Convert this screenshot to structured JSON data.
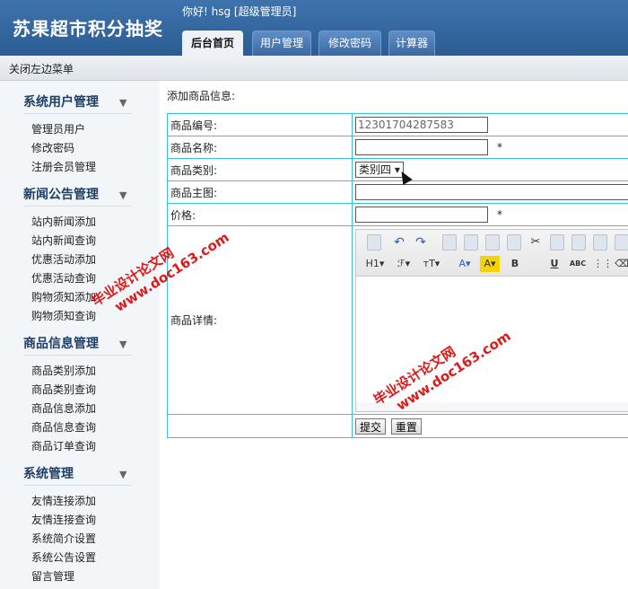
{
  "header": {
    "app_title": "苏果超市积分抽奖",
    "greeting": "你好! hsg [超级管理员]",
    "tabs": [
      "后台首页",
      "用户管理",
      "修改密码",
      "计算器"
    ]
  },
  "strip": {
    "close_menu": "关闭左边菜单"
  },
  "sidebar": {
    "groups": [
      {
        "title": "系统用户管理",
        "items": [
          "管理员用户",
          "修改密码",
          "注册会员管理"
        ]
      },
      {
        "title": "新闻公告管理",
        "items": [
          "站内新闻添加",
          "站内新闻查询",
          "优惠活动添加",
          "优惠活动查询",
          "购物须知添加",
          "购物须知查询"
        ]
      },
      {
        "title": "商品信息管理",
        "items": [
          "商品类别添加",
          "商品类别查询",
          "商品信息添加",
          "商品信息查询",
          "商品订单查询"
        ]
      },
      {
        "title": "系统管理",
        "items": [
          "友情连接添加",
          "友情连接查询",
          "系统简介设置",
          "系统公告设置",
          "留言管理"
        ]
      }
    ],
    "arrow": "▼"
  },
  "form": {
    "section_title": "添加商品信息:",
    "labels": {
      "code": "商品编号:",
      "name": "商品名称:",
      "category": "商品类别:",
      "image": "商品主图:",
      "price": "价格:",
      "details": "商品详情:"
    },
    "code_value": "12301704287583",
    "category_selected": "类别四",
    "required": "*",
    "editor": {
      "heading": "H1",
      "font": "ℱ",
      "size": "тT",
      "text_color": "A",
      "bg_color": "A",
      "bold": "B",
      "underline": "U",
      "abc": "ABC"
    },
    "submit": "提交",
    "reset": "重置"
  },
  "watermark": {
    "line1": "毕业设计论文网",
    "line2": "www.doc163.com"
  }
}
